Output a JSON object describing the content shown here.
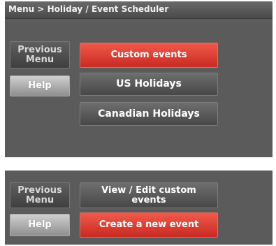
{
  "screen1": {
    "title": "Menu > Holiday / Event Scheduler",
    "previous_menu": "Previous\nMenu",
    "help": "Help",
    "options": {
      "custom_events": "Custom events",
      "us_holidays": "US Holidays",
      "canadian_holidays": "Canadian Holidays"
    }
  },
  "screen2": {
    "previous_menu": "Previous\nMenu",
    "help": "Help",
    "options": {
      "view_edit": "View / Edit custom\nevents",
      "create_new": "Create a new event"
    }
  },
  "colors": {
    "screen_bg": "#5b5b5b",
    "selected_red": "#e03a2f",
    "button_gray": "#555555"
  }
}
